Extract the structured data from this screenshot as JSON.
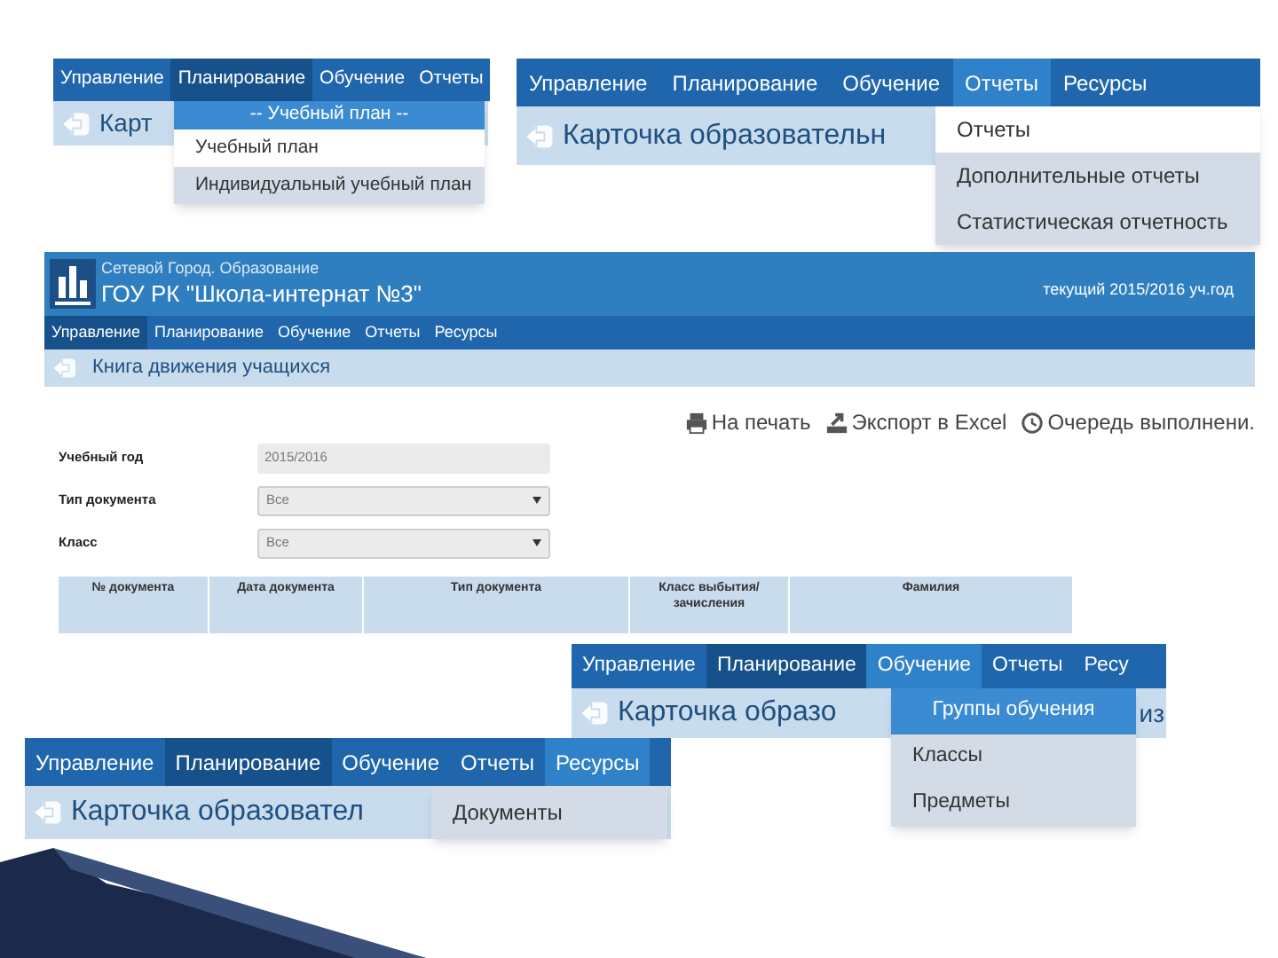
{
  "panels": [
    {
      "kind": "menu_snippet",
      "menu": [
        {
          "label": "Управление",
          "current": false,
          "selected": false
        },
        {
          "label": "Планирование",
          "current": true,
          "selected": false
        },
        {
          "label": "Обучение",
          "current": false,
          "selected": false
        },
        {
          "label": "Отчеты",
          "current": false,
          "selected": false
        }
      ],
      "title": "Карт",
      "dropdown": [
        {
          "kind": "header",
          "label": "-- Учебный план --"
        },
        {
          "kind": "item",
          "label": "Учебный план",
          "highlighted": true
        },
        {
          "kind": "item",
          "label": "Индивидуальный учебный план",
          "highlighted": false
        }
      ]
    },
    {
      "kind": "menu_snippet",
      "menu": [
        {
          "label": "Управление",
          "current": false,
          "selected": false
        },
        {
          "label": "Планирование",
          "current": false,
          "selected": false
        },
        {
          "label": "Обучение",
          "current": false,
          "selected": false
        },
        {
          "label": "Отчеты",
          "current": false,
          "selected": true
        },
        {
          "label": "Ресурсы",
          "current": false,
          "selected": false
        }
      ],
      "title": "Карточка образовательн",
      "dropdown": [
        {
          "kind": "item",
          "label": "Отчеты",
          "highlighted": true
        },
        {
          "kind": "item",
          "label": "Дополнительные отчеты",
          "highlighted": false
        },
        {
          "kind": "item",
          "label": "Статистическая отчетность",
          "highlighted": false
        }
      ]
    },
    {
      "kind": "journal_page",
      "system": "Сетевой Город. Образование",
      "school": "ГОУ РК \"Школа-интернат №3\"",
      "year": "текущий 2015/2016 уч.год",
      "menu": [
        {
          "label": "Управление",
          "current": true,
          "selected": false
        },
        {
          "label": "Планирование",
          "current": false,
          "selected": false
        },
        {
          "label": "Обучение",
          "current": false,
          "selected": false
        },
        {
          "label": "Отчеты",
          "current": false,
          "selected": false
        },
        {
          "label": "Ресурсы",
          "current": false,
          "selected": false
        }
      ],
      "title": "Книга движения учащихся",
      "actions": [
        {
          "kind": "print",
          "label": "На печать"
        },
        {
          "kind": "export",
          "label": "Экспорт в Excel"
        },
        {
          "kind": "queue",
          "label": "Очередь выполнени."
        }
      ],
      "filters": [
        {
          "kind": "text",
          "label": "Учебный год",
          "value": "2015/2016"
        },
        {
          "kind": "select",
          "label": "Тип документа",
          "value": "Все"
        },
        {
          "kind": "select",
          "label": "Класс",
          "value": "Все"
        }
      ],
      "table": {
        "columns": [
          "№ документа",
          "Дата документа",
          "Тип документа",
          "Класс выбытия/ зачисления",
          "Фамилия"
        ]
      }
    },
    {
      "kind": "menu_snippet",
      "menu": [
        {
          "label": "Управление",
          "current": false,
          "selected": false
        },
        {
          "label": "Планирование",
          "current": true,
          "selected": false
        },
        {
          "label": "Обучение",
          "current": false,
          "selected": true
        },
        {
          "label": "Отчеты",
          "current": false,
          "selected": false
        },
        {
          "label": "Ресу",
          "current": false,
          "selected": false
        }
      ],
      "title": "Карточка образо",
      "title_tail": "из",
      "dropdown": [
        {
          "kind": "header",
          "label": "Группы обучения"
        },
        {
          "kind": "item",
          "label": "Классы",
          "highlighted": false
        },
        {
          "kind": "item",
          "label": "Предметы",
          "highlighted": false
        }
      ]
    },
    {
      "kind": "menu_snippet",
      "menu": [
        {
          "label": "Управление",
          "current": false,
          "selected": false
        },
        {
          "label": "Планирование",
          "current": true,
          "selected": false
        },
        {
          "label": "Обучение",
          "current": false,
          "selected": false
        },
        {
          "label": "Отчеты",
          "current": false,
          "selected": false
        },
        {
          "label": "Ресурсы",
          "current": false,
          "selected": true
        }
      ],
      "title": "Карточка образовател",
      "dropdown": [
        {
          "kind": "item",
          "label": "Документы",
          "highlighted": false
        }
      ]
    }
  ]
}
